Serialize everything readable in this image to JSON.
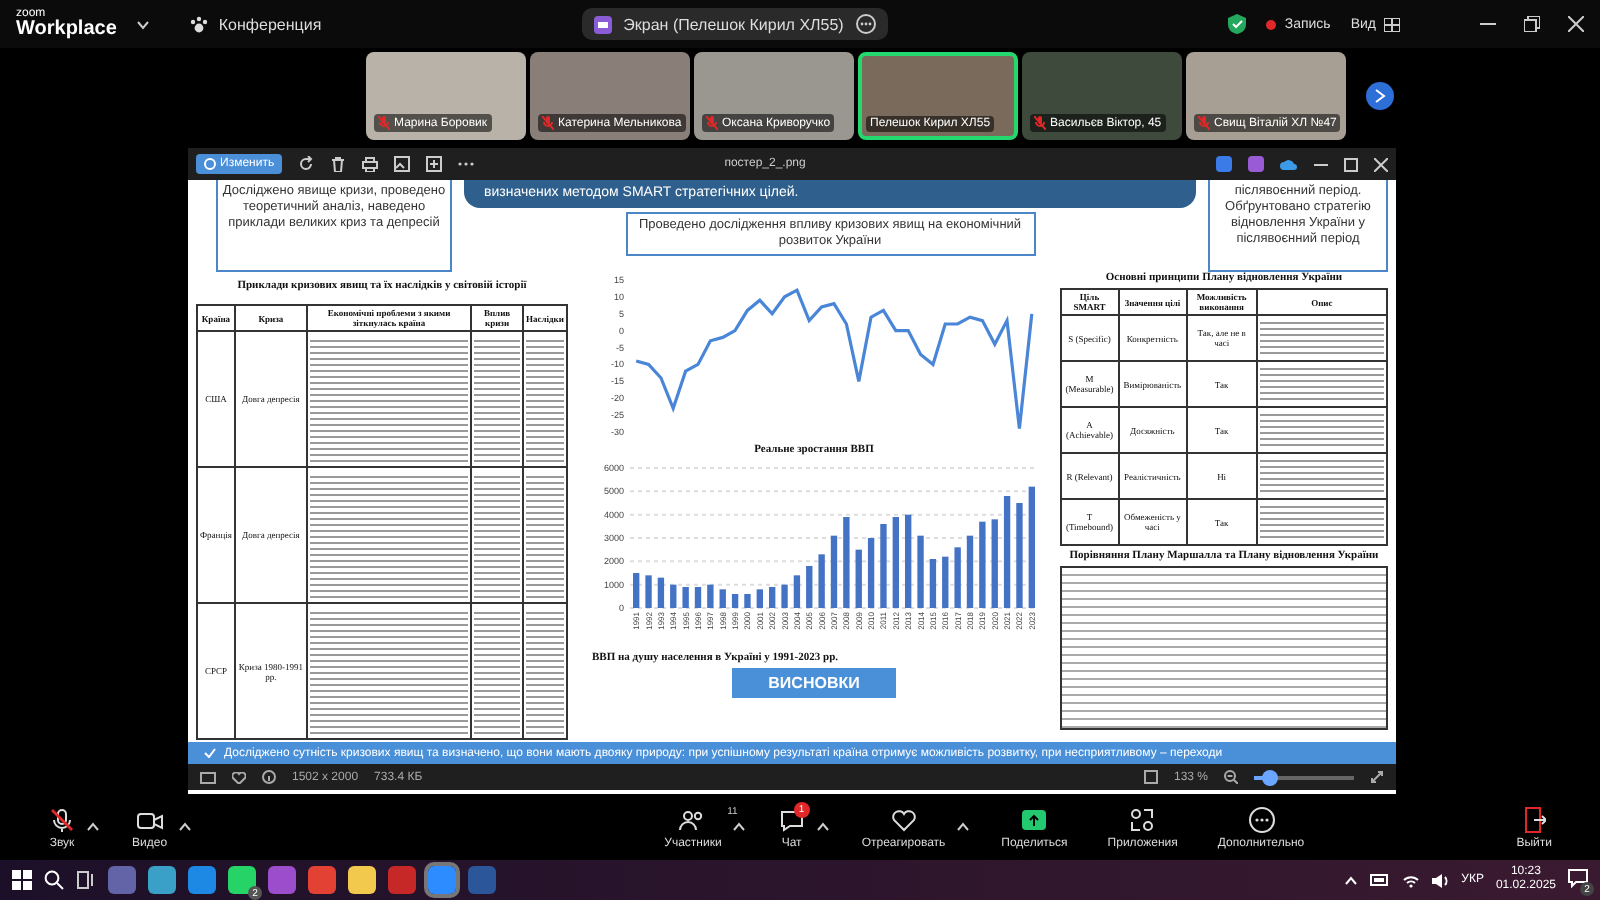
{
  "top_bar": {
    "app_name": "zoom",
    "app_subtitle": "Workplace",
    "meeting_label": "Конференция",
    "share_pill": "Экран (Пелешок Кирил ХЛ55)",
    "record_label": "Запись",
    "view_label": "Вид"
  },
  "participants": [
    {
      "name": "Марина Боровик",
      "muted": true,
      "speaking": false,
      "color": "#b9b2a8"
    },
    {
      "name": "Катерина Мельникова",
      "muted": true,
      "speaking": false,
      "color": "#8a7f78"
    },
    {
      "name": "Оксана Криворучко",
      "muted": true,
      "speaking": false,
      "color": "#9a9690"
    },
    {
      "name": "Пелешок Кирил ХЛ55",
      "muted": false,
      "speaking": true,
      "color": "#7a6a5c"
    },
    {
      "name": "Васильєв Віктор, 45",
      "muted": true,
      "speaking": false,
      "color": "#3e4a3c"
    },
    {
      "name": "Свищ Віталій ХЛ №47",
      "muted": true,
      "speaking": false,
      "color": "#a89f94"
    }
  ],
  "viewer": {
    "edit_button": "Изменить",
    "file_name": "постер_2_.png",
    "dimensions": "1502 x 2000",
    "file_size": "733.4 КБ",
    "zoom_level": "133 %",
    "zoom_slider": {
      "level": 0.15
    }
  },
  "poster": {
    "left_box": "Досліджено явище кризи, проведено теоретичний аналіз, наведено приклади великих криз та депресій",
    "banner": "визначених методом SMART стратегічних цілей.",
    "middle_box": "Проведено дослідження впливу кризових явищ на економічний розвиток України",
    "right_box": "післявоєнний період. Обґрунтовано стратегію відновлення України у післявоєнний період",
    "crisis_table": {
      "title": "Приклади кризових явищ та їх наслідків у світовій історії",
      "columns": [
        "Країна",
        "Криза",
        "Економічні проблеми з якими зіткнулась країна",
        "Вплив кризи",
        "Наслідки"
      ],
      "rows": [
        [
          "США",
          "Довга депресія"
        ],
        [
          "Франція",
          "Довга депресія"
        ],
        [
          "СРСР",
          "Криза 1980-1991 рр."
        ]
      ]
    },
    "line_chart": {
      "chart_data": {
        "type": "line",
        "title": "Реальне зростання ВВП",
        "grid": false,
        "series": [
          {
            "color": "#4a86d8",
            "values": [
              -9,
              -10,
              -14,
              -23,
              -12,
              -10,
              -3,
              -2,
              0,
              6,
              9,
              5,
              10,
              12,
              3,
              7,
              8,
              2,
              -15,
              4,
              6,
              0,
              0,
              -7,
              -10,
              2,
              2,
              4,
              3,
              -4,
              3,
              -29,
              5
            ]
          }
        ],
        "ylim": [
          -30,
          15
        ],
        "yticks": [
          -30,
          -25,
          -20,
          -15,
          -10,
          -5,
          0,
          5,
          10,
          15
        ]
      }
    },
    "bar_chart": {
      "chart_data": {
        "type": "bar",
        "title": "ВВП на душу населення в Україні у 1991-2023 рр.",
        "grid": true,
        "categories": [
          "1991",
          "1992",
          "1993",
          "1994",
          "1995",
          "1996",
          "1997",
          "1998",
          "1999",
          "2000",
          "2001",
          "2002",
          "2003",
          "2004",
          "2005",
          "2006",
          "2007",
          "2008",
          "2009",
          "2010",
          "2011",
          "2012",
          "2013",
          "2014",
          "2015",
          "2016",
          "2017",
          "2018",
          "2019",
          "2020",
          "2021",
          "2022",
          "2023"
        ],
        "series": [
          {
            "color": "#4472c4",
            "values": [
              1500,
              1400,
              1300,
              1000,
              900,
              900,
              1000,
              800,
              600,
              600,
              800,
              900,
              1000,
              1400,
              1800,
              2300,
              3100,
              3900,
              2500,
              3000,
              3600,
              3900,
              4000,
              3100,
              2100,
              2200,
              2600,
              3100,
              3700,
              3800,
              4800,
              4500,
              5200
            ]
          }
        ],
        "ylim": [
          0,
          6000
        ],
        "yticks": [
          0,
          1000,
          2000,
          3000,
          4000,
          5000,
          6000
        ]
      }
    },
    "conclusions_button": "ВИСНОВКИ",
    "smart_table": {
      "title": "Основні принципи Плану відновлення України",
      "columns": [
        "Ціль SMART",
        "Значення цілі",
        "Можливість виконання",
        "Опис"
      ],
      "rows": [
        [
          "S (Specific)",
          "Конкретність",
          "Так, але не в часі"
        ],
        [
          "M (Measurable)",
          "Вимірюваність",
          "Так"
        ],
        [
          "A (Achievable)",
          "Досяжність",
          "Так"
        ],
        [
          "R (Relevant)",
          "Реалістичність",
          "Ні"
        ],
        [
          "T (Timebound)",
          "Обмеженість у часі",
          "Так"
        ]
      ]
    },
    "comparison_title": "Порівняння Плану Маршалла та Плану відновлення України",
    "conclusion_text": "Досліджено сутність кризових явищ та визначено, що вони мають двояку природу: при успішному результаті країна отримує можливість розвитку, при несприятливому – переходи"
  },
  "toolbar": {
    "items": [
      {
        "kind": "mic",
        "label": "Звук",
        "muted": true,
        "menu": true
      },
      {
        "kind": "video",
        "label": "Видео",
        "menu": true
      },
      {
        "kind": "people",
        "label": "Участники",
        "count": "11",
        "menu": true
      },
      {
        "kind": "chat",
        "label": "Чат",
        "badge": "1",
        "menu": true
      },
      {
        "kind": "heart",
        "label": "Отреагировать",
        "menu": true
      },
      {
        "kind": "share",
        "label": "Поделиться",
        "menu": false
      },
      {
        "kind": "apps",
        "label": "Приложения",
        "menu": false
      },
      {
        "kind": "more",
        "label": "Дополнительно",
        "menu": false
      }
    ],
    "leave_label": "Выйти"
  },
  "taskbar": {
    "apps": [
      {
        "color": "#6264a7",
        "active": false
      },
      {
        "color": "#3aa0c8",
        "active": false
      },
      {
        "color": "#1e88e5",
        "active": false
      },
      {
        "color": "#25d366",
        "active": false,
        "badge": "2"
      },
      {
        "color": "#9c4dcc",
        "active": false
      },
      {
        "color": "#e34133",
        "active": false
      },
      {
        "color": "#f2c94c",
        "active": false
      },
      {
        "color": "#c62828",
        "active": false
      },
      {
        "color": "#2d8cff",
        "active": true
      },
      {
        "color": "#2b579a",
        "active": false
      }
    ],
    "language": "УКР",
    "time": "10:23",
    "date": "01.02.2025",
    "notifications": "2"
  }
}
